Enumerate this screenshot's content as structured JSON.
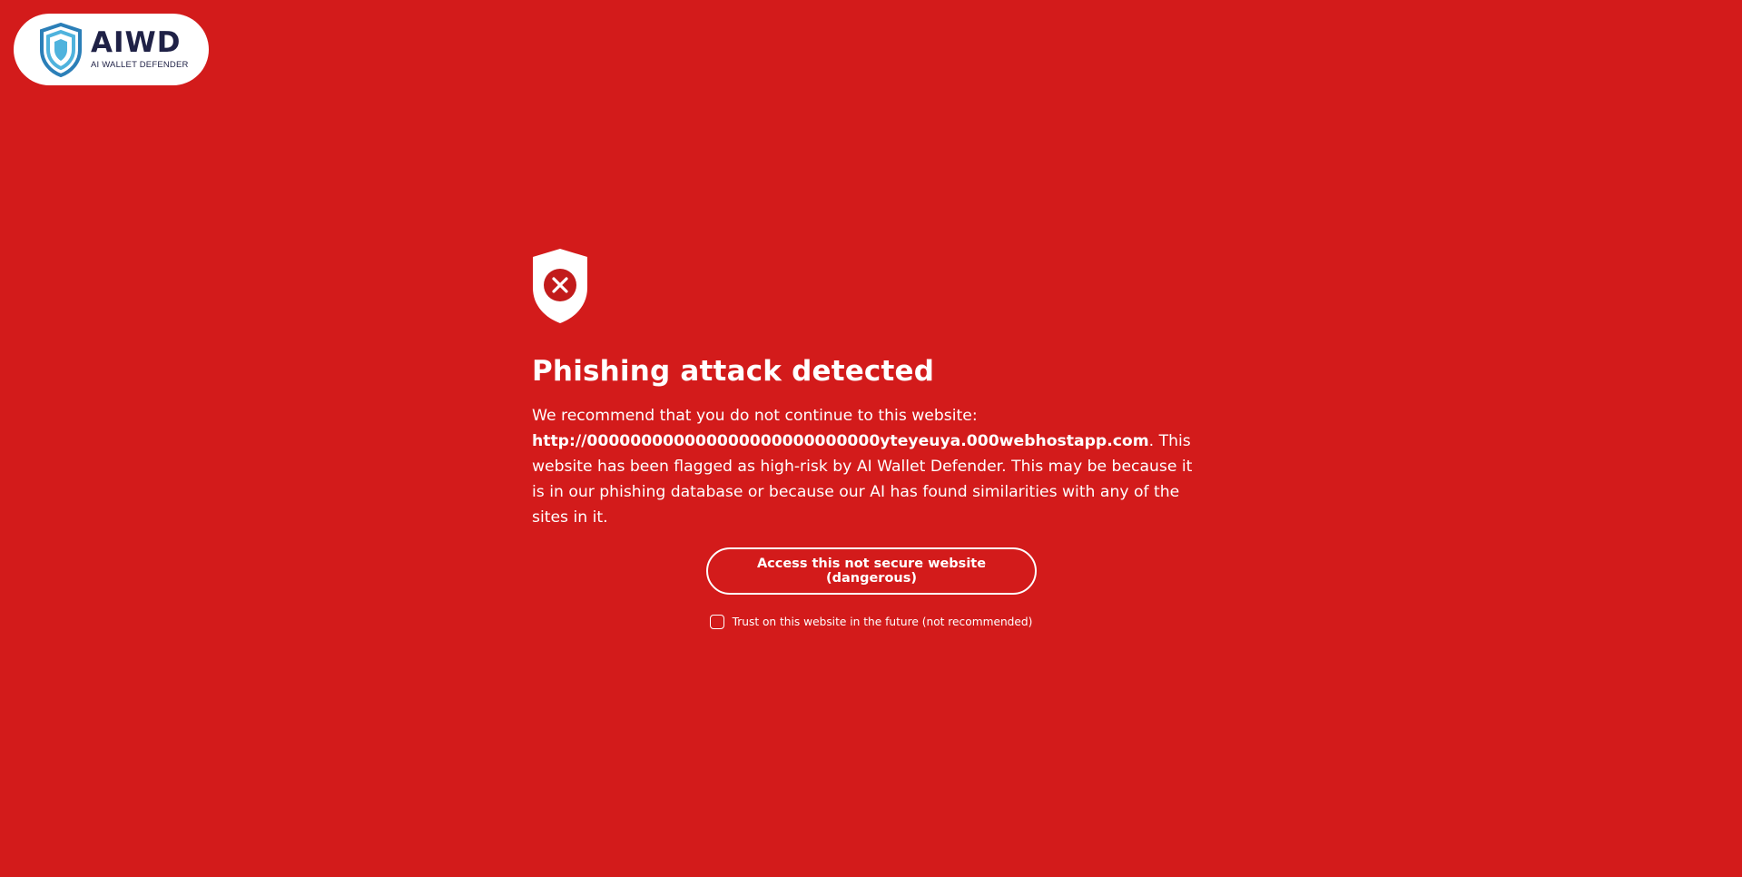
{
  "logo": {
    "title": "AIWD",
    "subtitle": "AI WALLET DEFENDER",
    "icon": "shield-logo-icon",
    "colors": {
      "light": "#4fb3dd",
      "dark": "#2b7fb8",
      "text": "#1f2146"
    }
  },
  "warning": {
    "icon": "shield-x-icon",
    "title": "Phishing attack detected",
    "intro": "We recommend that you do not continue to this website:",
    "url": "http://000000000000000000000000000yteyeuya.000webhostapp.com",
    "details": ". This website has been flagged as high-risk by AI Wallet Defender. This may be because it is in our phishing database or because our AI has found similarities with any of the sites in it."
  },
  "actions": {
    "access_label": "Access this not secure website (dangerous)",
    "trust_label": "Trust on this website in the future (not recommended)",
    "trust_checked": false
  },
  "colors": {
    "background": "#d31b1b",
    "foreground": "#ffffff"
  }
}
